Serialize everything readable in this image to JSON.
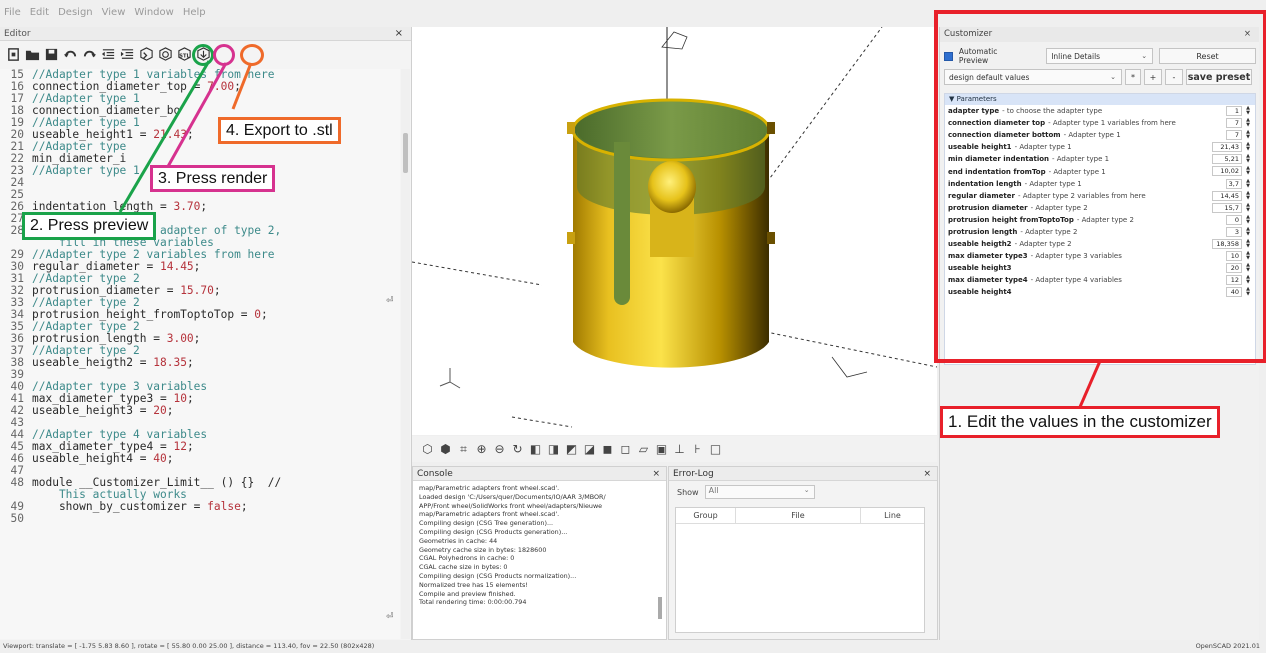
{
  "menu": [
    "File",
    "Edit",
    "Design",
    "View",
    "Window",
    "Help"
  ],
  "editor": {
    "title": "Editor",
    "close": "×",
    "lines": [
      {
        "n": "15",
        "parts": [
          [
            "cm",
            "//Adapter type 1 variables from here"
          ]
        ]
      },
      {
        "n": "16",
        "parts": [
          [
            "txt",
            "connection_diameter_top = "
          ],
          [
            "num",
            "7.00"
          ],
          [
            "txt",
            ";"
          ]
        ]
      },
      {
        "n": "17",
        "parts": [
          [
            "cm",
            "//Adapter type 1"
          ]
        ]
      },
      {
        "n": "18",
        "parts": [
          [
            "txt",
            "connection_diameter_bo"
          ]
        ]
      },
      {
        "n": "19",
        "parts": [
          [
            "cm",
            "//Adapter type 1"
          ]
        ]
      },
      {
        "n": "20",
        "parts": [
          [
            "txt",
            "useable_height1 = "
          ],
          [
            "num",
            "21.43"
          ],
          [
            "txt",
            ";"
          ]
        ]
      },
      {
        "n": "21",
        "parts": [
          [
            "cm",
            "//Adapter type"
          ]
        ]
      },
      {
        "n": "22",
        "parts": [
          [
            "txt",
            "min_diameter_i"
          ]
        ]
      },
      {
        "n": "23",
        "parts": [
          [
            "cm",
            "//Adapter type 1"
          ]
        ]
      },
      {
        "n": "24",
        "parts": [
          [
            "txt",
            "                  fromTop = "
          ],
          [
            "num",
            "10.02"
          ],
          [
            "txt",
            ";"
          ]
        ]
      },
      {
        "n": "25",
        "parts": []
      },
      {
        "n": "26",
        "parts": [
          [
            "txt",
            "indentation_length = "
          ],
          [
            "num",
            "3.70"
          ],
          [
            "txt",
            ";"
          ]
        ]
      },
      {
        "n": "27",
        "parts": []
      },
      {
        "n": "28",
        "parts": [
          [
            "cm",
            "//If you have a an adapter of type 2,"
          ]
        ]
      },
      {
        "n": "",
        "parts": [
          [
            "cm",
            "    fill in these variables"
          ]
        ]
      },
      {
        "n": "29",
        "parts": [
          [
            "cm",
            "//Adapter type 2 variables from here"
          ]
        ]
      },
      {
        "n": "30",
        "parts": [
          [
            "txt",
            "regular_diameter = "
          ],
          [
            "num",
            "14.45"
          ],
          [
            "txt",
            ";"
          ]
        ]
      },
      {
        "n": "31",
        "parts": [
          [
            "cm",
            "//Adapter type 2"
          ]
        ]
      },
      {
        "n": "32",
        "parts": [
          [
            "txt",
            "protrusion_diameter = "
          ],
          [
            "num",
            "15.70"
          ],
          [
            "txt",
            ";"
          ]
        ]
      },
      {
        "n": "33",
        "parts": [
          [
            "cm",
            "//Adapter type 2"
          ]
        ]
      },
      {
        "n": "34",
        "parts": [
          [
            "txt",
            "protrusion_height_fromToptoTop = "
          ],
          [
            "num",
            "0"
          ],
          [
            "txt",
            ";"
          ]
        ]
      },
      {
        "n": "35",
        "parts": [
          [
            "cm",
            "//Adapter type 2"
          ]
        ]
      },
      {
        "n": "36",
        "parts": [
          [
            "txt",
            "protrusion_length = "
          ],
          [
            "num",
            "3.00"
          ],
          [
            "txt",
            ";"
          ]
        ]
      },
      {
        "n": "37",
        "parts": [
          [
            "cm",
            "//Adapter type 2"
          ]
        ]
      },
      {
        "n": "38",
        "parts": [
          [
            "txt",
            "useable_heigth2 = "
          ],
          [
            "num",
            "18.35"
          ],
          [
            "txt",
            ";"
          ]
        ]
      },
      {
        "n": "39",
        "parts": []
      },
      {
        "n": "40",
        "parts": [
          [
            "cm",
            "//Adapter type 3 variables"
          ]
        ]
      },
      {
        "n": "41",
        "parts": [
          [
            "txt",
            "max_diameter_type3 = "
          ],
          [
            "num",
            "10"
          ],
          [
            "txt",
            ";"
          ]
        ]
      },
      {
        "n": "42",
        "parts": [
          [
            "txt",
            "useable_height3 = "
          ],
          [
            "num",
            "20"
          ],
          [
            "txt",
            ";"
          ]
        ]
      },
      {
        "n": "43",
        "parts": []
      },
      {
        "n": "44",
        "parts": [
          [
            "cm",
            "//Adapter type 4 variables"
          ]
        ]
      },
      {
        "n": "45",
        "parts": [
          [
            "txt",
            "max_diameter_type4 = "
          ],
          [
            "num",
            "12"
          ],
          [
            "txt",
            ";"
          ]
        ]
      },
      {
        "n": "46",
        "parts": [
          [
            "txt",
            "useable_height4 = "
          ],
          [
            "num",
            "40"
          ],
          [
            "txt",
            ";"
          ]
        ]
      },
      {
        "n": "47",
        "parts": []
      },
      {
        "n": "48",
        "parts": [
          [
            "txt",
            "module __Customizer_Limit__ () {}  //"
          ]
        ]
      },
      {
        "n": "",
        "parts": [
          [
            "cm",
            "    This actually works"
          ]
        ]
      },
      {
        "n": "49",
        "parts": [
          [
            "txt",
            "    shown_by_customizer = "
          ],
          [
            "num",
            "false"
          ],
          [
            "txt",
            ";"
          ]
        ]
      },
      {
        "n": "50",
        "parts": []
      }
    ]
  },
  "console": {
    "title": "Console",
    "close": "×",
    "lines": [
      "map/Parametric adapters front wheel.scad'.",
      "Loaded design 'C:/Users/quer/Documents/IO/AAR 3/MBOR/",
      "APP/Front wheel/SolidWorks front wheel/adapters/Nieuwe",
      "map/Parametric adapters front wheel.scad'.",
      "Compiling design (CSG Tree generation)...",
      "Compiling design (CSG Products generation)...",
      "Geometries in cache: 44",
      "Geometry cache size in bytes: 1828600",
      "CGAL Polyhedrons in cache: 0",
      "CGAL cache size in bytes: 0",
      "Compiling design (CSG Products normalization)...",
      "Normalized tree has 15 elements!",
      "Compile and preview finished.",
      "Total rendering time: 0:00:00.794"
    ]
  },
  "errorlog": {
    "title": "Error-Log",
    "close": "×",
    "show_label": "Show",
    "show_value": "All",
    "columns": [
      "Group",
      "File",
      "Line"
    ]
  },
  "customizer": {
    "title": "Customizer",
    "close": "×",
    "auto_preview": "Automatic Preview",
    "detail_select": "Inline Details",
    "reset": "Reset",
    "preset_select": "design default values",
    "star": "*",
    "plus": "+",
    "minus": "-",
    "save_preset": "save preset",
    "params_header": "Parameters",
    "params": [
      {
        "name": "adapter type",
        "desc": "- to choose the adapter type",
        "value": "1"
      },
      {
        "name": "connection diameter top",
        "desc": "- Adapter type 1 variables from here",
        "value": "7"
      },
      {
        "name": "connection diameter bottom",
        "desc": "- Adapter type 1",
        "value": "7"
      },
      {
        "name": "useable height1",
        "desc": "- Adapter type 1",
        "value": "21,43"
      },
      {
        "name": "min diameter indentation",
        "desc": "- Adapter type 1",
        "value": "5,21"
      },
      {
        "name": "end indentation fromTop",
        "desc": "- Adapter type 1",
        "value": "10,02"
      },
      {
        "name": "indentation length",
        "desc": "- Adapter type 1",
        "value": "3,7"
      },
      {
        "name": "regular diameter",
        "desc": "- Adapter type 2 variables from here",
        "value": "14,45"
      },
      {
        "name": "protrusion diameter",
        "desc": "- Adapter type 2",
        "value": "15,7"
      },
      {
        "name": "protrusion height fromToptoTop",
        "desc": "- Adapter type 2",
        "value": "0"
      },
      {
        "name": "protrusion length",
        "desc": "- Adapter type 2",
        "value": "3"
      },
      {
        "name": "useable heigth2",
        "desc": "- Adapter type 2",
        "value": "18,358"
      },
      {
        "name": "max diameter type3",
        "desc": "- Adapter type 3 variables",
        "value": "10"
      },
      {
        "name": "useable height3",
        "desc": "",
        "value": "20"
      },
      {
        "name": "max diameter type4",
        "desc": "- Adapter type 4 variables",
        "value": "12"
      },
      {
        "name": "useable height4",
        "desc": "",
        "value": "40"
      }
    ]
  },
  "annotations": {
    "step1": "1. Edit the values in the customizer",
    "step2": "2. Press preview",
    "step3": "3. Press render",
    "step4": "4. Export to .stl",
    "colors": {
      "red": "#e8202a",
      "green": "#1aa34a",
      "magenta": "#d6328f",
      "orange": "#ef6a2a"
    }
  },
  "toolbar": {
    "stl_label": "STL"
  },
  "status": {
    "viewport": "Viewport: translate = [ -1.75 5.83 8.60 ], rotate = [ 55.80 0.00 25.00 ], distance = 113.40, fov = 22.50 (802x428)",
    "version": "OpenSCAD 2021.01"
  }
}
